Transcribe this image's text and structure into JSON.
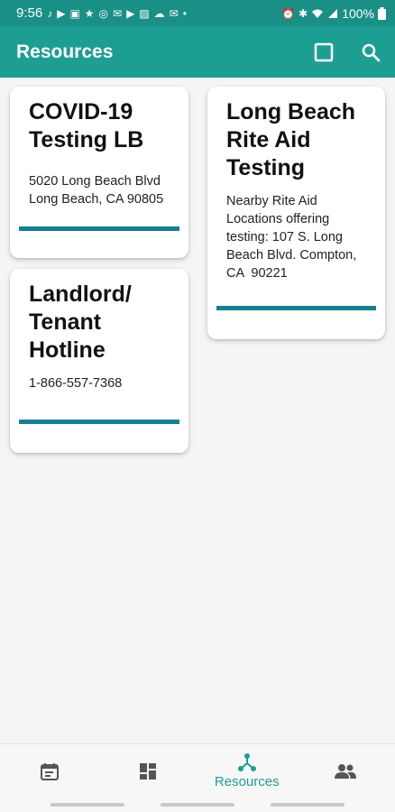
{
  "status_bar": {
    "time": "9:56",
    "battery": "100%",
    "notification_icons": [
      "tiktok-icon",
      "youtube-icon",
      "gallery-icon",
      "star-icon",
      "messenger-icon",
      "gmail-icon",
      "youtube-icon",
      "photos-icon",
      "cloud-icon",
      "gmail-icon",
      "dot-icon"
    ],
    "system_icons": [
      "alarm-icon",
      "bluetooth-icon",
      "wifi-icon",
      "signal-icon",
      "battery-icon"
    ]
  },
  "app_bar": {
    "title": "Resources",
    "actions": [
      "square-icon",
      "search-icon"
    ]
  },
  "cards": [
    {
      "title_lines": [
        "COVID-19",
        "Testing LB"
      ],
      "body_lines": [
        "5020 Long Beach Blvd",
        "Long Beach, CA 90805"
      ]
    },
    {
      "title_lines": [
        "Landlord/",
        "Tenant",
        "Hotline"
      ],
      "body_lines": [
        "1-866-557-7368"
      ]
    },
    {
      "title_lines": [
        "Long Beach",
        "Rite Aid",
        "Testing"
      ],
      "body_lines": [
        "Nearby Rite Aid",
        "Locations offering",
        "testing: 107 S. Long",
        "Beach Blvd. Compton,",
        "CA  90221"
      ]
    }
  ],
  "bottom_nav": {
    "items": [
      {
        "icon": "calendar-icon",
        "label": ""
      },
      {
        "icon": "dashboard-icon",
        "label": ""
      },
      {
        "icon": "resources-icon",
        "label": "Resources"
      },
      {
        "icon": "people-icon",
        "label": ""
      }
    ],
    "active_index": 2
  },
  "colors": {
    "status_bar": "#1a8f85",
    "app_bar": "#1d9e93",
    "card_accent": "#177f93",
    "active_nav": "#1d9e93"
  }
}
